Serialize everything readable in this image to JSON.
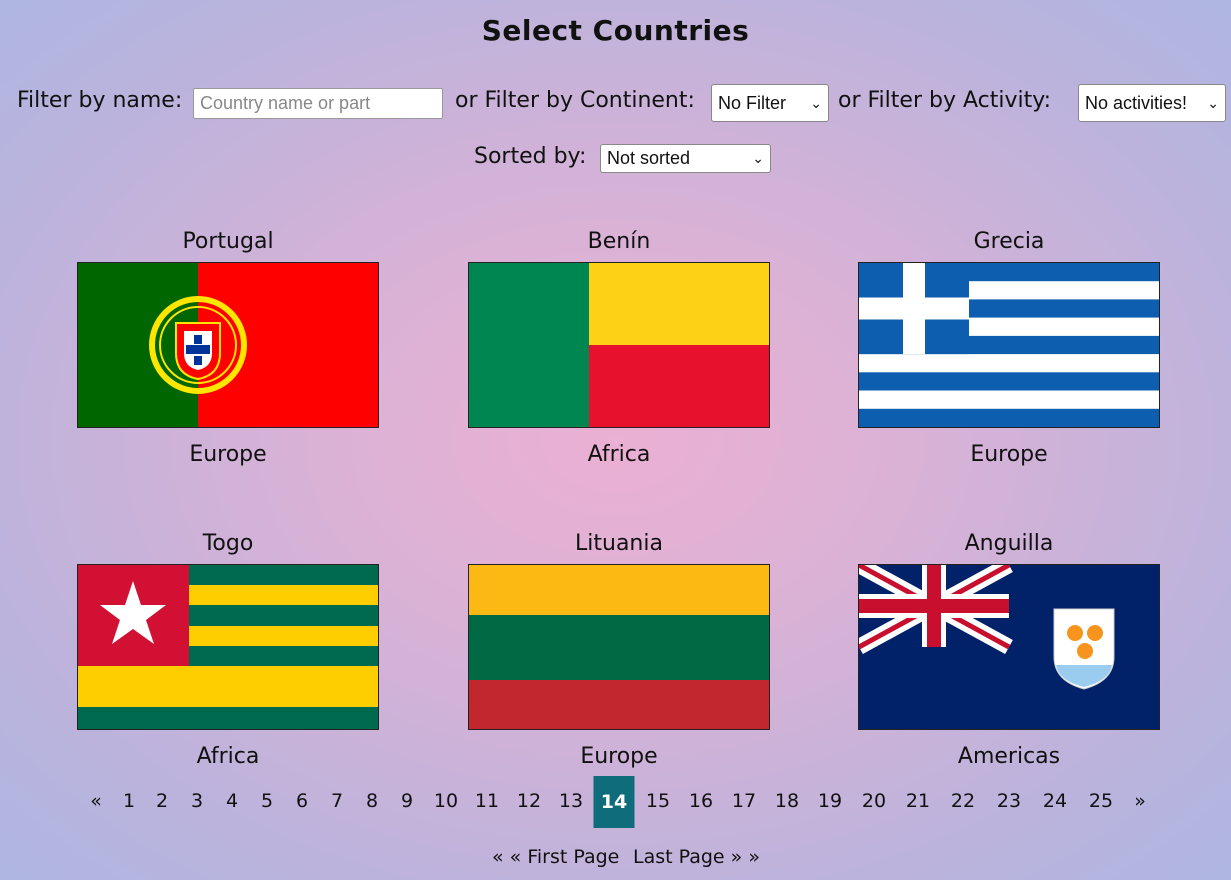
{
  "page_title": "Select Countries",
  "filters": {
    "name_label": "Filter by name:",
    "name_placeholder": "Country name or part",
    "continent_label": "or Filter by Continent:",
    "continent_value": "No Filter",
    "activity_label": "or Filter by Activity:",
    "activity_value": "No activities!",
    "sort_label": "Sorted by:",
    "sort_value": "Not sorted"
  },
  "countries": [
    {
      "name": "Portugal",
      "continent": "Europe"
    },
    {
      "name": "Benín",
      "continent": "Africa"
    },
    {
      "name": "Grecia",
      "continent": "Europe"
    },
    {
      "name": "Togo",
      "continent": "Africa"
    },
    {
      "name": "Lituania",
      "continent": "Europe"
    },
    {
      "name": "Anguilla",
      "continent": "Americas"
    }
  ],
  "pagination": {
    "prev": "«",
    "next": "»",
    "pages": [
      "1",
      "2",
      "3",
      "4",
      "5",
      "6",
      "7",
      "8",
      "9",
      "10",
      "11",
      "12",
      "13",
      "14",
      "15",
      "16",
      "17",
      "18",
      "19",
      "20",
      "21",
      "22",
      "23",
      "24",
      "25"
    ],
    "current": "14",
    "first_page": "« « First Page",
    "last_page": "Last Page » »"
  },
  "colors": {
    "active_page": "#0f6d7b"
  }
}
